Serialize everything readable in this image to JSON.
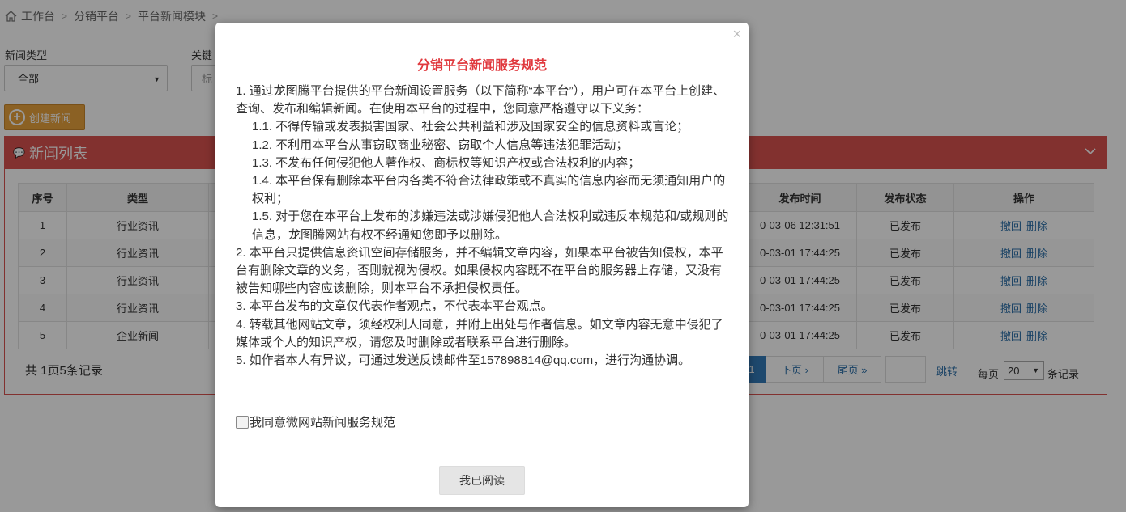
{
  "breadcrumb": [
    "工作台",
    "分销平台",
    "平台新闻模块"
  ],
  "filters": {
    "news_type_label": "新闻类型",
    "news_type_value": "全部",
    "keyword_label": "关键",
    "keyword_placeholder": "标"
  },
  "create_button": "创建新闻",
  "panel_title": "新闻列表",
  "table": {
    "headers": [
      "序号",
      "类型",
      "发布时间",
      "发布状态",
      "操作"
    ],
    "rows": [
      {
        "no": "1",
        "type": "行业资讯",
        "time": "0-03-06 12:31:51",
        "status": "已发布"
      },
      {
        "no": "2",
        "type": "行业资讯",
        "time": "0-03-01 17:44:25",
        "status": "已发布"
      },
      {
        "no": "3",
        "type": "行业资讯",
        "time": "0-03-01 17:44:25",
        "status": "已发布"
      },
      {
        "no": "4",
        "type": "行业资讯",
        "time": "0-03-01 17:44:25",
        "status": "已发布"
      },
      {
        "no": "5",
        "type": "企业新闻",
        "time": "0-03-01 17:44:25",
        "status": "已发布"
      }
    ],
    "action_revoke": "撤回",
    "action_delete": "删除"
  },
  "pagination": {
    "summary": "共 1页5条记录",
    "current": "1",
    "next": "下页 ›",
    "last": "尾页 »",
    "jump": "跳转",
    "per_page_label": "每页",
    "per_page_value": "20",
    "per_page_suffix": "条记录"
  },
  "modal": {
    "title": "分销平台新闻服务规范",
    "close": "×",
    "paragraphs": [
      "1. 通过龙图腾平台提供的平台新闻设置服务（以下简称“本平台”），用户可在本平台上创建、查询、发布和编辑新闻。在使用本平台的过程中，您同意严格遵守以下义务：",
      "1.1. 不得传输或发表损害国家、社会公共利益和涉及国家安全的信息资料或言论；",
      "1.2. 不利用本平台从事窃取商业秘密、窃取个人信息等违法犯罪活动；",
      "1.3. 不发布任何侵犯他人著作权、商标权等知识产权或合法权利的内容；",
      "1.4. 本平台保有删除本平台内各类不符合法律政策或不真实的信息内容而无须通知用户的权利；",
      "1.5. 对于您在本平台上发布的涉嫌违法或涉嫌侵犯他人合法权利或违反本规范和/或规则的信息，龙图腾网站有权不经通知您即予以删除。",
      "2. 本平台只提供信息资讯空间存储服务，并不编辑文章内容，如果本平台被告知侵权，本平台有删除文章的义务，否则就视为侵权。如果侵权内容既不在平台的服务器上存储，又没有被告知哪些内容应该删除，则本平台不承担侵权责任。",
      "3. 本平台发布的文章仅代表作者观点，不代表本平台观点。",
      "4. 转载其他网站文章，须经权利人同意，并附上出处与作者信息。如文章内容无意中侵犯了媒体或个人的知识产权，请您及时删除或者联系平台进行删除。",
      "5. 如作者本人有异议，可通过发送反馈邮件至157898814@qq.com，进行沟通协调。"
    ],
    "agree_label": "我同意微网站新闻服务规范",
    "read_button": "我已阅读"
  },
  "colors": {
    "panel_red": "#d9534f",
    "create_orange": "#e8a23d",
    "title_red": "#e0393e",
    "link_blue": "#2a6ea8"
  }
}
